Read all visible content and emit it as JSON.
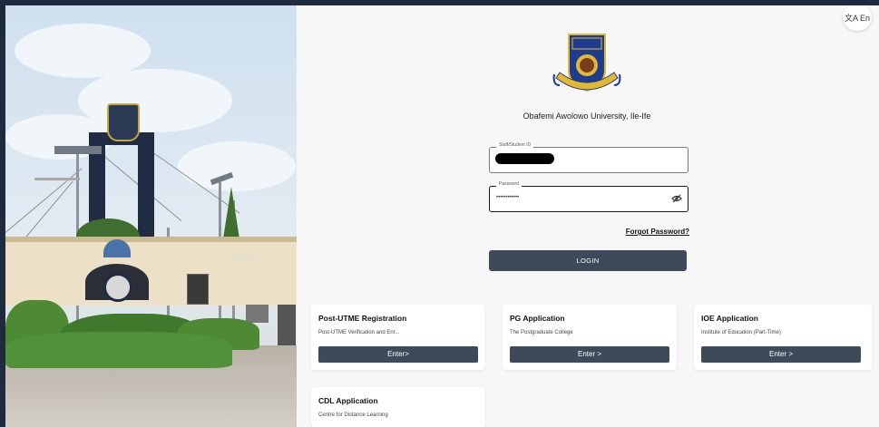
{
  "header": {
    "lang_label": "文A En",
    "university_name": "Obafemi Awolowo University, Ile-Ife"
  },
  "form": {
    "id_label": "Staff/Student ID",
    "password_label": "Password",
    "password_value": "••••••••••••",
    "forgot_label": "Forgot Password?",
    "login_label": "LOGIN"
  },
  "cards": [
    {
      "title": "Post-UTME Registration",
      "desc": "Post-UTME Verification and Enr...",
      "button": "Enter>"
    },
    {
      "title": "PG Application",
      "desc": "The Postgraduate College",
      "button": "Enter >"
    },
    {
      "title": "IOE Application",
      "desc": "Institute of Education (Part-Time)",
      "button": "Enter >"
    },
    {
      "title": "CDL Application",
      "desc": "Centre for Distance Learning",
      "button": ""
    }
  ],
  "logo": {
    "motto": "FOR LEARNING AND CULTURE"
  },
  "colors": {
    "button": "#3d4a59",
    "frame": "#1e2a3d",
    "logo_blue": "#1d3c8f",
    "logo_gold": "#e2b830"
  }
}
